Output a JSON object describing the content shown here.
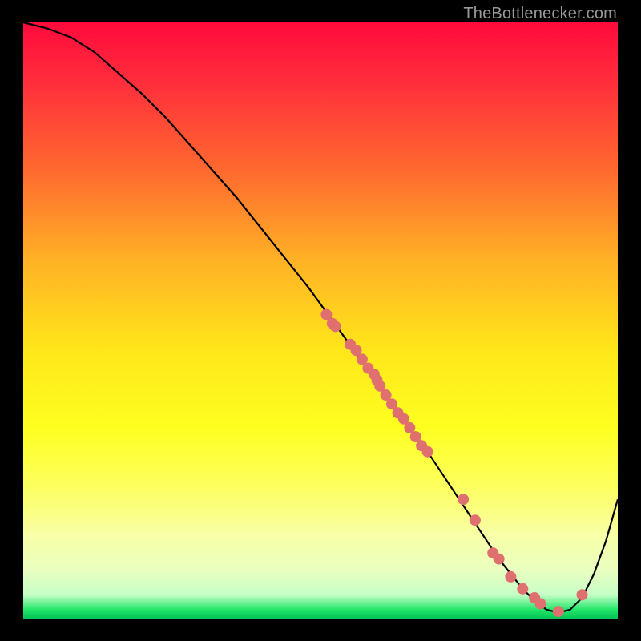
{
  "watermark": "TheBottlenecker.com",
  "chart_data": {
    "type": "line",
    "title": "",
    "xlabel": "",
    "ylabel": "",
    "xlim": [
      0,
      100
    ],
    "ylim": [
      0,
      100
    ],
    "series": [
      {
        "name": "curve",
        "x": [
          0,
          4,
          8,
          12,
          16,
          20,
          24,
          28,
          32,
          36,
          40,
          44,
          48,
          52,
          56,
          60,
          64,
          68,
          72,
          76,
          78,
          80,
          82,
          84,
          86,
          88,
          90,
          92,
          94,
          96,
          98,
          100
        ],
        "y": [
          100,
          99,
          97.5,
          95,
          91.5,
          88,
          84,
          79.5,
          75,
          70.5,
          65.5,
          60.5,
          55.5,
          50,
          44.5,
          39,
          33.5,
          28,
          22,
          16,
          13,
          10,
          7.5,
          5,
          3,
          1.5,
          1,
          1.5,
          3.5,
          7.5,
          13,
          20
        ]
      }
    ],
    "scatter_points": {
      "x": [
        51,
        52,
        52.5,
        55,
        56,
        57,
        58,
        59,
        59.5,
        60,
        61,
        62,
        63,
        64,
        65,
        66,
        67,
        68,
        74,
        76,
        79,
        80,
        82,
        84,
        86,
        87,
        90,
        94
      ],
      "y": [
        51,
        49.5,
        49,
        46,
        45,
        43.5,
        42,
        41,
        40,
        39,
        37.5,
        36,
        34.5,
        33.5,
        32,
        30.5,
        29,
        28,
        20,
        16.5,
        11,
        10,
        7,
        5,
        3.5,
        2.5,
        1.2,
        4
      ]
    }
  }
}
